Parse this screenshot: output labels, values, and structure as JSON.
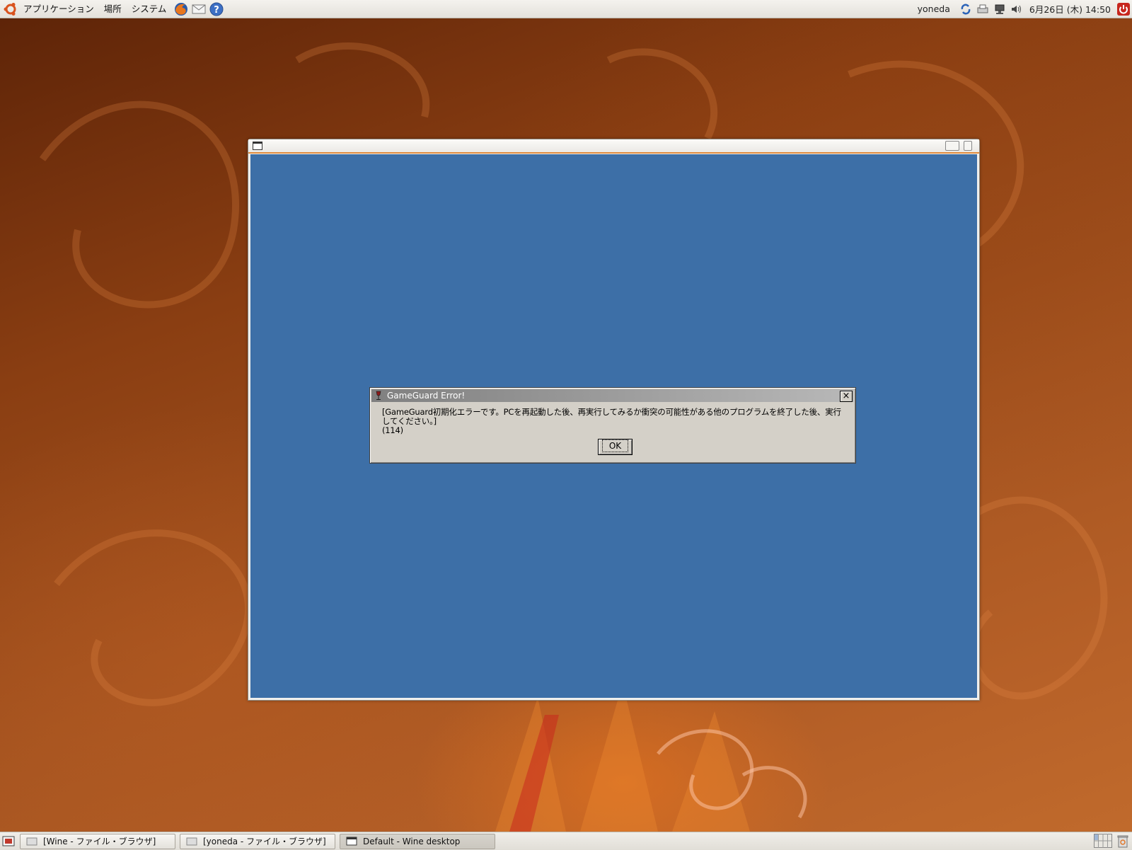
{
  "top_panel": {
    "menus": [
      "アプリケーション",
      "場所",
      "システム"
    ],
    "launchers": [
      "firefox-icon",
      "mail-icon",
      "help-icon"
    ],
    "username": "yoneda",
    "clock": "6月26日 (木) 14:50"
  },
  "wine_window": {
    "title": ""
  },
  "dialog": {
    "title": "GameGuard Error!",
    "message_line1": "[GameGuard初期化エラーです。PCを再起動した後、再実行してみるか衝突の可能性がある他のプログラムを終了した後、実行してください。]",
    "message_line2": "(114)",
    "ok_label": "OK",
    "close_label": "×"
  },
  "taskbar": {
    "tasks": [
      {
        "label": "[Wine - ファイル・ブラウザ]",
        "active": false
      },
      {
        "label": "[yoneda - ファイル・ブラウザ]",
        "active": false
      },
      {
        "label": "Default - Wine desktop",
        "active": true
      }
    ]
  },
  "colors": {
    "wine_desktop": "#3d6fa7",
    "dialog_bg": "#d4d0c8",
    "panel_bg": "#ece9e4",
    "accent": "#e08a3c"
  }
}
